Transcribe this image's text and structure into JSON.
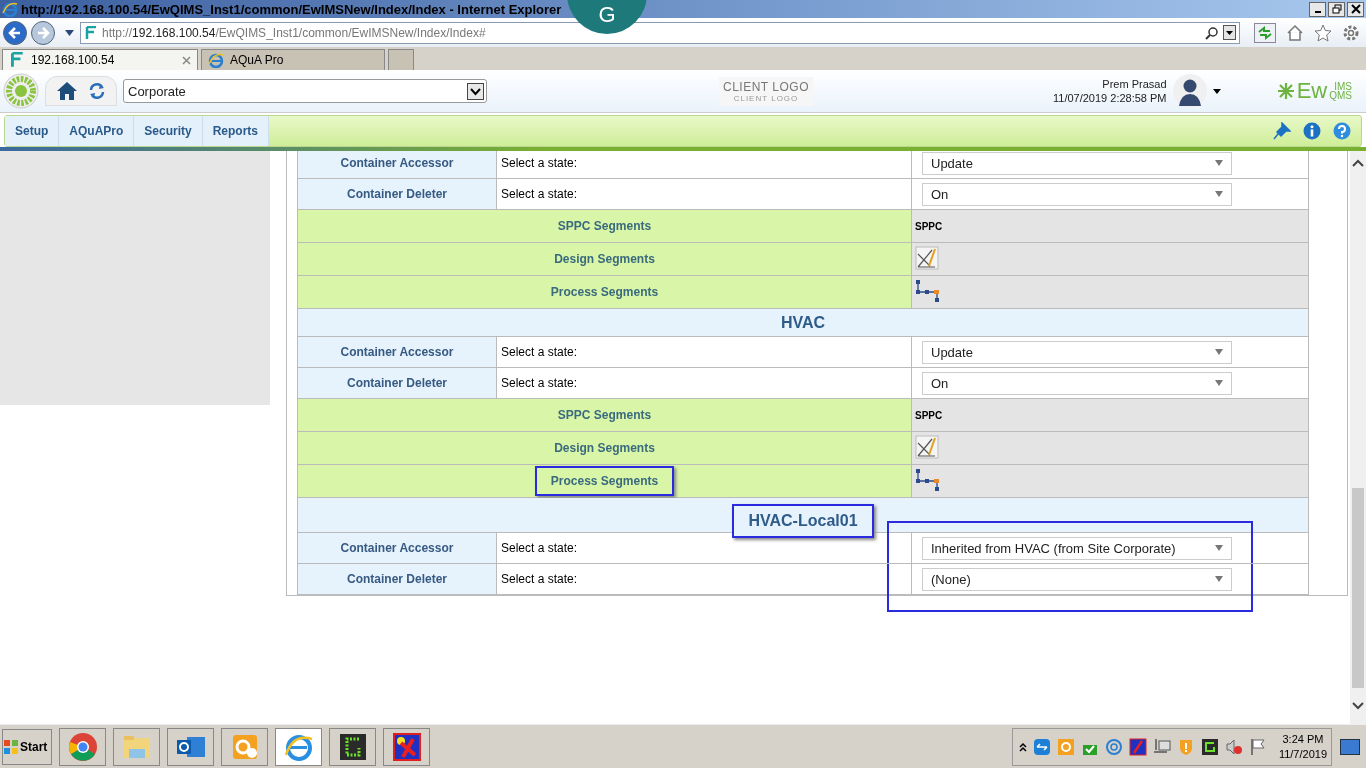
{
  "browser": {
    "title": "http://192.168.100.54/EwQIMS_Inst1/common/EwIMSNew/Index/Index - Internet Explorer",
    "address": {
      "scheme": "http://",
      "host": "192.168.100.54",
      "path": "/EwQIMS_Inst1/common/EwIMSNew/Index/Index#"
    },
    "tabs": [
      {
        "label": "192.168.100.54",
        "selected": true
      },
      {
        "label": "AQuA Pro",
        "selected": false
      }
    ],
    "floating_badge": "G"
  },
  "header": {
    "site": "Corporate",
    "client_logo": "CLIENT LOGO",
    "client_logo_sub": "CLIENT LOGO",
    "user_name": "Prem Prasad",
    "datetime": "11/07/2019 2:28:58 PM",
    "brand": {
      "main": "Ew",
      "top": "IMS",
      "bottom": "QMS"
    }
  },
  "menu": [
    {
      "label": "Setup"
    },
    {
      "label": "AQuAPro"
    },
    {
      "label": "Security"
    },
    {
      "label": "Reports"
    }
  ],
  "rows": [
    {
      "kind": "state",
      "label": "Container Accessor",
      "prompt": "Select a state:",
      "value": "Update",
      "highlighted": false
    },
    {
      "kind": "state",
      "label": "Container Deleter",
      "prompt": "Select a state:",
      "value": "On",
      "highlighted": false
    },
    {
      "kind": "text_segment",
      "label": "SPPC Segments",
      "value": "SPPC",
      "highlighted": false
    },
    {
      "kind": "design_segment",
      "label": "Design Segments",
      "highlighted": false
    },
    {
      "kind": "process_segment",
      "label": "Process Segments",
      "highlighted": false
    },
    {
      "kind": "heading",
      "title": "HVAC",
      "highlighted": false
    },
    {
      "kind": "state",
      "label": "Container Accessor",
      "prompt": "Select a state:",
      "value": "Update",
      "highlighted": false
    },
    {
      "kind": "state",
      "label": "Container Deleter",
      "prompt": "Select a state:",
      "value": "On",
      "highlighted": false
    },
    {
      "kind": "text_segment",
      "label": "SPPC Segments",
      "value": "SPPC",
      "highlighted": false
    },
    {
      "kind": "design_segment",
      "label": "Design Segments",
      "highlighted": false
    },
    {
      "kind": "process_segment",
      "label": "Process Segments",
      "highlighted": true
    },
    {
      "kind": "heading",
      "title": "HVAC-Local01",
      "highlighted": true
    },
    {
      "kind": "state",
      "label": "Container Accessor",
      "prompt": "Select a state:",
      "value": "Inherited from HVAC (from Site Corporate)",
      "highlighted": true
    },
    {
      "kind": "state",
      "label": "Container Deleter",
      "prompt": "Select a state:",
      "value": "(None)",
      "highlighted": true
    }
  ],
  "taskbar": {
    "start": "Start",
    "clock_time": "3:24 PM",
    "clock_date": "11/7/2019"
  }
}
